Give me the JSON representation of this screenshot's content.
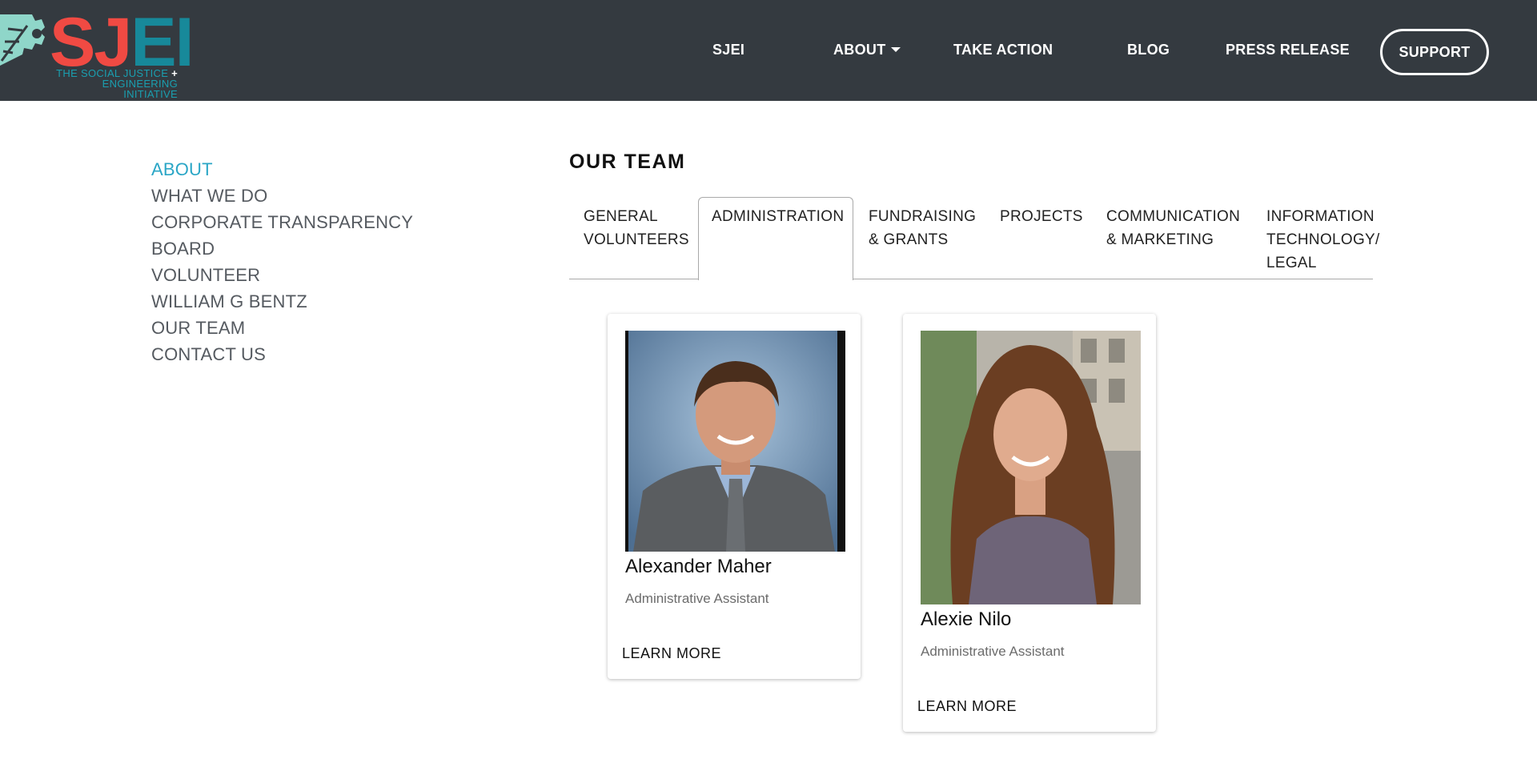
{
  "brand": {
    "logo_text_left": "SJ",
    "logo_text_right": "EI",
    "tagline_line1": "THE SOCIAL JUSTICE",
    "tagline_plus": "+",
    "tagline_line2": "ENGINEERING INITIATIVE",
    "colors": {
      "red": "#f04a43",
      "teal": "#17899a",
      "mint": "#8fd6c9",
      "navbar": "#343a40"
    }
  },
  "nav": {
    "items": [
      {
        "label": "SJEI"
      },
      {
        "label": "ABOUT",
        "icon": "caret-down-icon"
      },
      {
        "label": "TAKE ACTION"
      },
      {
        "label": "BLOG"
      },
      {
        "label": "PRESS RELEASE"
      }
    ],
    "support_label": "SUPPORT"
  },
  "sidebar": {
    "items": [
      {
        "label": "ABOUT",
        "active": true
      },
      {
        "label": "WHAT WE DO"
      },
      {
        "label": "CORPORATE TRANSPARENCY"
      },
      {
        "label": "BOARD"
      },
      {
        "label": "VOLUNTEER"
      },
      {
        "label": "WILLIAM G BENTZ"
      },
      {
        "label": "OUR TEAM"
      },
      {
        "label": "CONTACT US"
      }
    ],
    "active_color": "#2aa6c6"
  },
  "main": {
    "title": "OUR TEAM",
    "tabs": [
      {
        "line1": "GENERAL",
        "line2": "VOLUNTEERS"
      },
      {
        "line1": "ADMINISTRATION",
        "active": true
      },
      {
        "line1": "FUNDRAISING",
        "line2": "& GRANTS"
      },
      {
        "line1": "PROJECTS"
      },
      {
        "line1": "COMMUNICATION",
        "line2": "& MARKETING"
      },
      {
        "line1": "INFORMATION",
        "line2": "TECHNOLOGY/",
        "line3": "LEGAL"
      }
    ],
    "members": [
      {
        "name": "Alexander Maher",
        "role": "Administrative Assistant",
        "link": "LEARN MORE"
      },
      {
        "name": "Alexie Nilo",
        "role": "Administrative Assistant",
        "link": "LEARN MORE"
      }
    ]
  }
}
